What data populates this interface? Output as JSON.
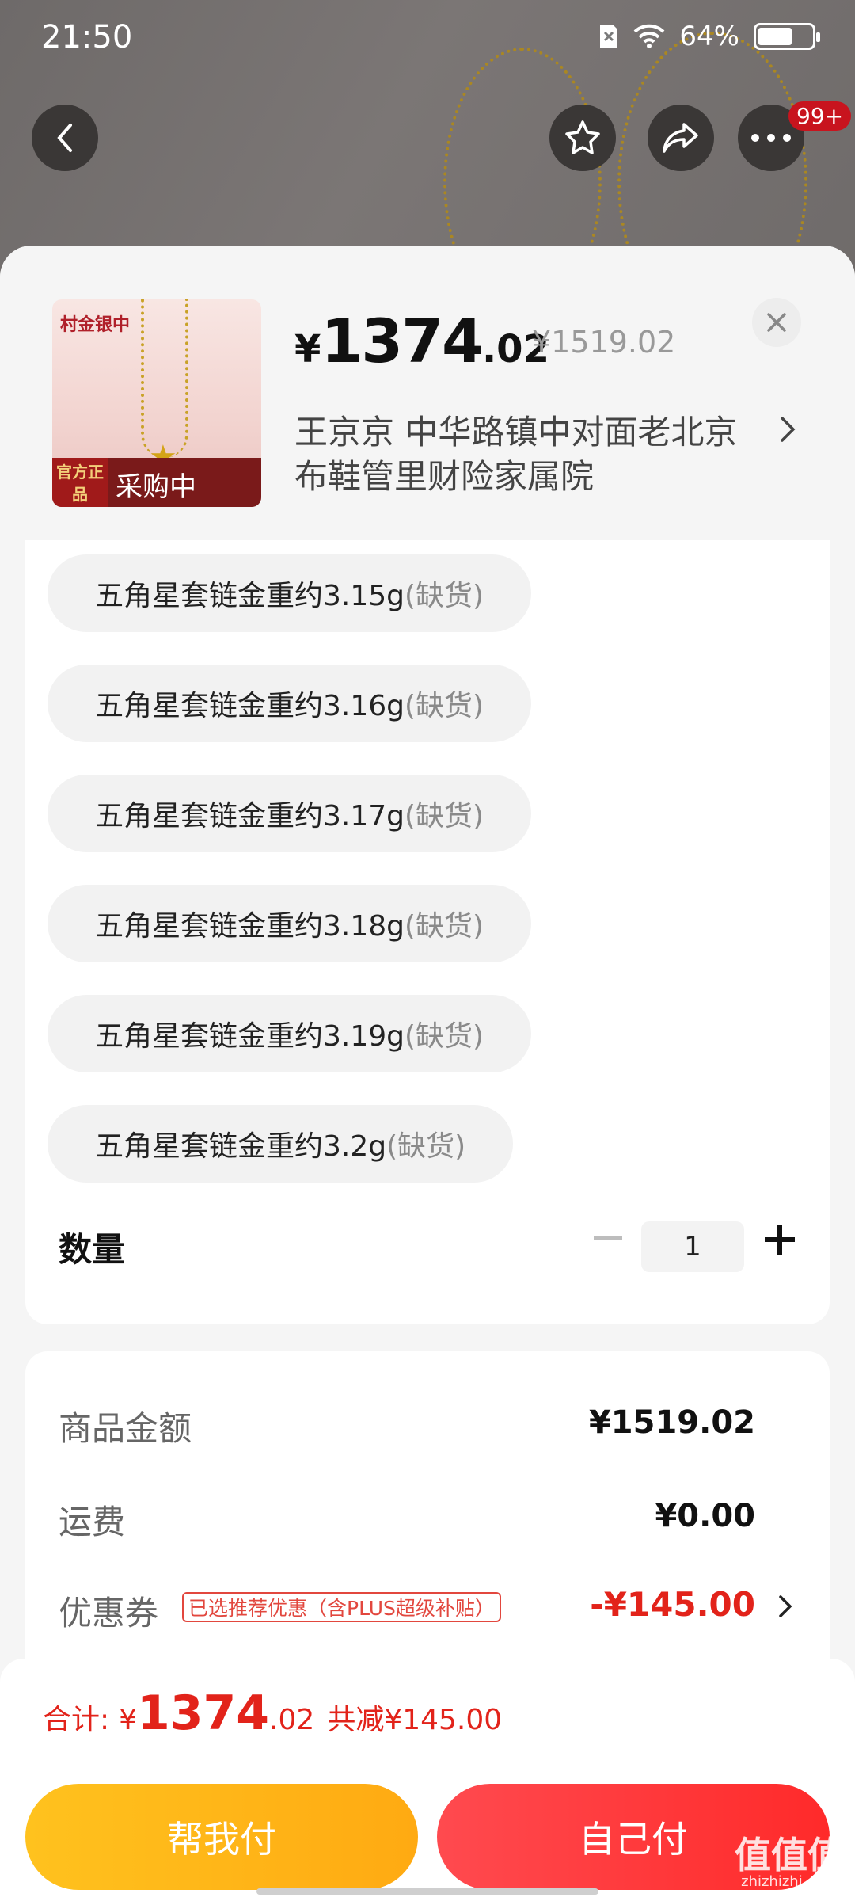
{
  "status_bar": {
    "time": "21:50",
    "battery": "64%"
  },
  "header": {
    "badge": "99+"
  },
  "product": {
    "thumb_brand": "村金银中",
    "thumb_official": "官方正品",
    "thumb_tag": "采购中",
    "price_yen": "¥",
    "price_int": "1374",
    "price_dec": ".02",
    "original_price": "¥1519.02",
    "address": "王京京  中华路镇中对面老北京布鞋管里财险家属院"
  },
  "options": [
    {
      "name": "五角星套链金重约3.15g",
      "status": "(缺货)"
    },
    {
      "name": "五角星套链金重约3.16g",
      "status": "(缺货)"
    },
    {
      "name": "五角星套链金重约3.17g",
      "status": "(缺货)"
    },
    {
      "name": "五角星套链金重约3.18g",
      "status": "(缺货)"
    },
    {
      "name": "五角星套链金重约3.19g",
      "status": "(缺货)"
    },
    {
      "name": "五角星套链金重约3.2g",
      "status": "(缺货)"
    }
  ],
  "quantity": {
    "label": "数量",
    "value": "1"
  },
  "summary": {
    "goods_label": "商品金额",
    "goods_value": "¥1519.02",
    "shipping_label": "运费",
    "shipping_value": "¥0.00",
    "coupon_label": "优惠券",
    "coupon_tag": "已选推荐优惠（含PLUS超级补贴）",
    "coupon_value": "-¥145.00"
  },
  "footer": {
    "total_label": "合计:",
    "total_yen": "¥",
    "total_int": "1374",
    "total_dec": ".02",
    "saved": "共减¥145.00",
    "help_pay": "帮我付",
    "self_pay": "自己付"
  },
  "watermark": {
    "text": "值值值",
    "url": "zhizhizhi.com"
  },
  "colors": {
    "accent_red": "#e2231a",
    "help_btn": "#ffb31a",
    "self_btn": "#ff3a3d"
  }
}
